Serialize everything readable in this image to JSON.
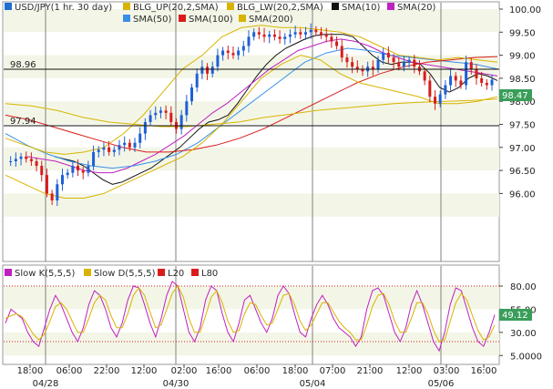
{
  "chart_data": [
    {
      "type": "line",
      "title": "USD/JPY(1 hr. 30 day)",
      "legend": [
        {
          "name": "USD/JPY(1 hr. 30 day)",
          "color": "#1f6fd1"
        },
        {
          "name": "BLG_UP(20,2,SMA)",
          "color": "#d8b400"
        },
        {
          "name": "BLG_LW(20,2,SMA)",
          "color": "#d8b400"
        },
        {
          "name": "SMA(10)",
          "color": "#111111"
        },
        {
          "name": "SMA(20)",
          "color": "#c020c0"
        },
        {
          "name": "SMA(50)",
          "color": "#3a8fe8"
        },
        {
          "name": "SMA(100)",
          "color": "#d81c1c"
        },
        {
          "name": "SMA(200)",
          "color": "#d8b400"
        }
      ],
      "ylim": [
        95.5,
        100.2
      ],
      "yticks": [
        "100.00",
        "99.50",
        "99.00",
        "98.50",
        "98.00",
        "97.50",
        "97.00",
        "96.50",
        "96.00"
      ],
      "last_price_label": "98.47",
      "last_price": 98.47,
      "levels": [
        {
          "label": "98.96",
          "value": 98.96
        },
        {
          "label": "97.94",
          "value": 97.94
        }
      ],
      "x": [
        0,
        2,
        4,
        6,
        8,
        10,
        12,
        14,
        16,
        18,
        20,
        22,
        24,
        26,
        28,
        30,
        32,
        34,
        36,
        38,
        40,
        42,
        44,
        46,
        48,
        50,
        52,
        54,
        56,
        58,
        60,
        62,
        64,
        66,
        68,
        70,
        72,
        74,
        76,
        78,
        80,
        82,
        84,
        86,
        88,
        90,
        92,
        94,
        96,
        98,
        100,
        102,
        104,
        106,
        108,
        110,
        112,
        114,
        116,
        118,
        120,
        122,
        124,
        126,
        128,
        130,
        132,
        134,
        136,
        138,
        140,
        142,
        144,
        146,
        148,
        150,
        152,
        154,
        156,
        158,
        160,
        162,
        164,
        166,
        168,
        170,
        172,
        174,
        176,
        178,
        180,
        182,
        184,
        186,
        188,
        190,
        192,
        194,
        196,
        198,
        200,
        202,
        204,
        206,
        208,
        210,
        212,
        214,
        216,
        218,
        220,
        222,
        224,
        226,
        228,
        230,
        232,
        234,
        236,
        238,
        240,
        242,
        244,
        246,
        248,
        250,
        252,
        254,
        256,
        258,
        260,
        262,
        264,
        266,
        268
      ],
      "series": [
        {
          "name": "USD/JPY(1 hr. 30 day)",
          "values": [
            96.7,
            96.7,
            96.75,
            96.8,
            96.75,
            96.7,
            96.6,
            96.4,
            96.0,
            95.85,
            96.2,
            96.4,
            96.45,
            96.6,
            96.5,
            96.45,
            96.6,
            96.9,
            96.95,
            97.0,
            96.9,
            96.95,
            97.05,
            97.1,
            97.0,
            97.1,
            97.3,
            97.55,
            97.7,
            97.75,
            97.8,
            97.75,
            97.55,
            97.4,
            97.7,
            98.0,
            98.3,
            98.6,
            98.75,
            98.6,
            98.75,
            99.0,
            99.1,
            99.05,
            99.0,
            99.1,
            99.2,
            99.4,
            99.5,
            99.45,
            99.4,
            99.45,
            99.4,
            99.35,
            99.4,
            99.45,
            99.5,
            99.45,
            99.5,
            99.55,
            99.5,
            99.45,
            99.4,
            99.3,
            99.2,
            98.95,
            98.85,
            98.75,
            98.7,
            98.65,
            98.75,
            98.7,
            98.9,
            99.05,
            98.95,
            98.85,
            98.75,
            98.85,
            98.9,
            98.75,
            98.65,
            98.45,
            98.1,
            97.95,
            98.15,
            98.35,
            98.55,
            98.45,
            98.35,
            98.85,
            98.7,
            98.5,
            98.4,
            98.35,
            98.47
          ]
        },
        {
          "name": "SMA(10)",
          "values": [
            96.8,
            96.75,
            96.7,
            96.6,
            96.45,
            96.3,
            96.2,
            96.25,
            96.35,
            96.45,
            96.55,
            96.7,
            96.85,
            97.0,
            97.2,
            97.4,
            97.55,
            97.6,
            97.7,
            97.95,
            98.25,
            98.55,
            98.8,
            99.0,
            99.15,
            99.25,
            99.35,
            99.42,
            99.45,
            99.45,
            99.45,
            99.4,
            99.2,
            99.0,
            98.85,
            98.8,
            98.85,
            98.85,
            98.8,
            98.6,
            98.3,
            98.2,
            98.3,
            98.5,
            98.6,
            98.55,
            98.45
          ]
        },
        {
          "name": "SMA(20)",
          "values": [
            96.8,
            96.75,
            96.7,
            96.6,
            96.5,
            96.45,
            96.45,
            96.55,
            96.7,
            96.85,
            97.05,
            97.25,
            97.5,
            97.75,
            97.95,
            98.2,
            98.45,
            98.7,
            98.9,
            99.1,
            99.2,
            99.3,
            99.35,
            99.3,
            99.2,
            99.05,
            98.95,
            98.85,
            98.8,
            98.75,
            98.7,
            98.65,
            98.6,
            98.55
          ]
        },
        {
          "name": "SMA(50)",
          "values": [
            97.3,
            97.05,
            96.85,
            96.7,
            96.6,
            96.55,
            96.6,
            96.7,
            96.85,
            97.1,
            97.45,
            97.8,
            98.15,
            98.5,
            98.85,
            99.05,
            99.15,
            99.1,
            99.0,
            98.95,
            98.9,
            98.85,
            98.8,
            98.7
          ]
        },
        {
          "name": "SMA(100)",
          "values": [
            97.7,
            97.6,
            97.45,
            97.3,
            97.15,
            97.0,
            96.9,
            96.9,
            96.95,
            97.05,
            97.2,
            97.4,
            97.65,
            97.9,
            98.15,
            98.4,
            98.6,
            98.75,
            98.85,
            98.9,
            98.95,
            98.97
          ]
        },
        {
          "name": "SMA(200)",
          "values": [
            97.95,
            97.9,
            97.8,
            97.65,
            97.55,
            97.5,
            97.45,
            97.45,
            97.5,
            97.55,
            97.65,
            97.72,
            97.8,
            97.85,
            97.9,
            97.95,
            97.98,
            98.0,
            98.02,
            98.05
          ]
        },
        {
          "name": "BLG_UP(20,2,SMA)",
          "values": [
            97.2,
            97.05,
            96.9,
            96.85,
            96.9,
            97.0,
            97.3,
            97.7,
            98.2,
            98.7,
            99.0,
            99.4,
            99.6,
            99.65,
            99.6,
            99.6,
            99.55,
            99.5,
            99.4,
            99.2,
            99.0,
            98.95,
            98.9,
            98.95,
            98.9,
            98.85
          ]
        },
        {
          "name": "BLG_LW(20,2,SMA)",
          "values": [
            96.4,
            96.2,
            96.0,
            95.9,
            95.9,
            96.0,
            96.2,
            96.4,
            96.6,
            96.8,
            97.1,
            97.5,
            98.0,
            98.5,
            98.8,
            99.0,
            98.9,
            98.6,
            98.4,
            98.3,
            98.2,
            98.1,
            97.95,
            97.95,
            98.0,
            98.1
          ]
        }
      ],
      "xticks": [
        "18:00",
        "06:00",
        "22:00",
        "12:00",
        "02:00",
        "16:00",
        "06:00",
        "18:00",
        "07:00",
        "21:00",
        "12:00",
        "03:00",
        "16:00"
      ],
      "xdates": [
        "04/28",
        "04/30",
        "05/04",
        "05/06"
      ]
    },
    {
      "type": "line",
      "legend": [
        {
          "name": "Slow K(5,5,5)",
          "color": "#c020c0"
        },
        {
          "name": "Slow D(5,5,5)",
          "color": "#d8b400"
        },
        {
          "name": "L20",
          "color": "#d81c1c"
        },
        {
          "name": "L80",
          "color": "#d81c1c"
        }
      ],
      "ylim": [
        0,
        100
      ],
      "yticks": [
        "80.00",
        "55.00",
        "30.00",
        "5.0000"
      ],
      "last_value_label": "49.12",
      "last_value": 49.12,
      "levels": [
        {
          "name": "L20",
          "value": 20
        },
        {
          "name": "L80",
          "value": 80
        }
      ],
      "series": [
        {
          "name": "Slow K(5,5,5)",
          "values": [
            40,
            55,
            50,
            45,
            30,
            20,
            15,
            35,
            55,
            70,
            60,
            45,
            30,
            20,
            35,
            60,
            75,
            70,
            55,
            35,
            25,
            40,
            65,
            80,
            78,
            60,
            40,
            25,
            45,
            70,
            85,
            80,
            55,
            30,
            20,
            35,
            65,
            80,
            75,
            50,
            30,
            20,
            40,
            65,
            70,
            55,
            40,
            30,
            45,
            70,
            80,
            72,
            50,
            30,
            25,
            45,
            60,
            70,
            60,
            45,
            35,
            30,
            25,
            15,
            25,
            55,
            75,
            78,
            70,
            50,
            30,
            20,
            35,
            60,
            75,
            60,
            40,
            20,
            10,
            30,
            60,
            78,
            75,
            55,
            35,
            20,
            15,
            30,
            49
          ]
        },
        {
          "name": "Slow D(5,5,5)",
          "values": [
            45,
            48,
            50,
            47,
            38,
            28,
            22,
            28,
            42,
            58,
            62,
            55,
            42,
            30,
            30,
            45,
            62,
            70,
            65,
            48,
            35,
            35,
            50,
            70,
            78,
            70,
            52,
            35,
            38,
            55,
            72,
            80,
            68,
            45,
            30,
            30,
            48,
            68,
            75,
            62,
            42,
            30,
            32,
            50,
            62,
            60,
            48,
            38,
            40,
            55,
            70,
            72,
            60,
            42,
            32,
            38,
            50,
            62,
            62,
            52,
            42,
            35,
            30,
            22,
            22,
            38,
            58,
            70,
            72,
            60,
            42,
            30,
            30,
            45,
            62,
            62,
            50,
            32,
            20,
            22,
            42,
            62,
            72,
            65,
            48,
            32,
            22,
            25,
            38
          ]
        }
      ]
    }
  ]
}
